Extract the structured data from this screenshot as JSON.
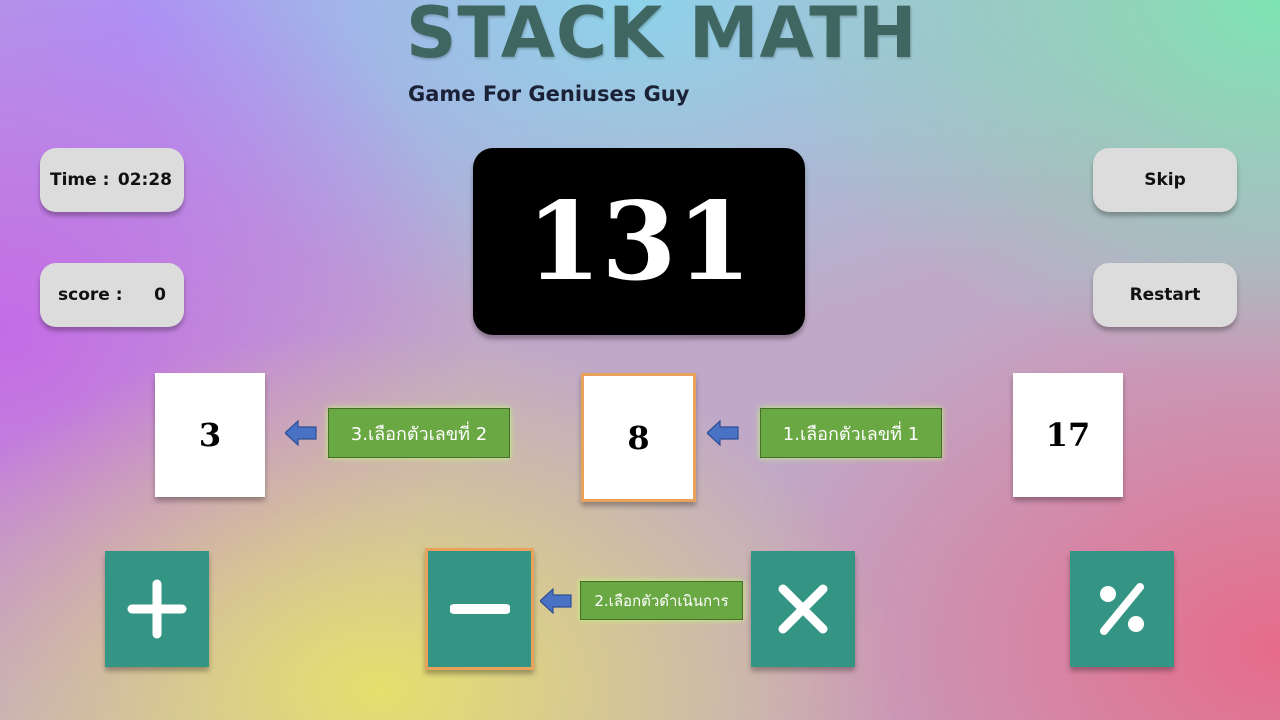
{
  "header": {
    "title": "STACK MATH",
    "subtitle": "Game For Geniuses Guy"
  },
  "stats": {
    "time_label": "Time :",
    "time_value": "02:28",
    "score_label": "score :",
    "score_value": "0"
  },
  "controls": {
    "skip_label": "Skip",
    "restart_label": "Restart"
  },
  "target": {
    "value": "131"
  },
  "cards": [
    {
      "value": "3"
    },
    {
      "value": "8",
      "selected": true
    },
    {
      "value": "17"
    }
  ],
  "operators": [
    {
      "name": "plus",
      "icon": "plus-icon"
    },
    {
      "name": "minus",
      "icon": "minus-icon",
      "selected": true
    },
    {
      "name": "times",
      "icon": "times-icon"
    },
    {
      "name": "percent",
      "icon": "percent-icon"
    }
  ],
  "hints": {
    "step1": "1.เลือกตัวเลขที่ 1",
    "step2": "2.เลือกตัวดำเนินการ",
    "step3": "3.เลือกตัวเลขที่ 2"
  },
  "colors": {
    "title": "#3f6660",
    "operator_tile": "#359585",
    "selected_border": "#e8a25c",
    "hint_bg": "#6aa844",
    "arrow": "#4a72c4",
    "target_bg": "#000000"
  }
}
